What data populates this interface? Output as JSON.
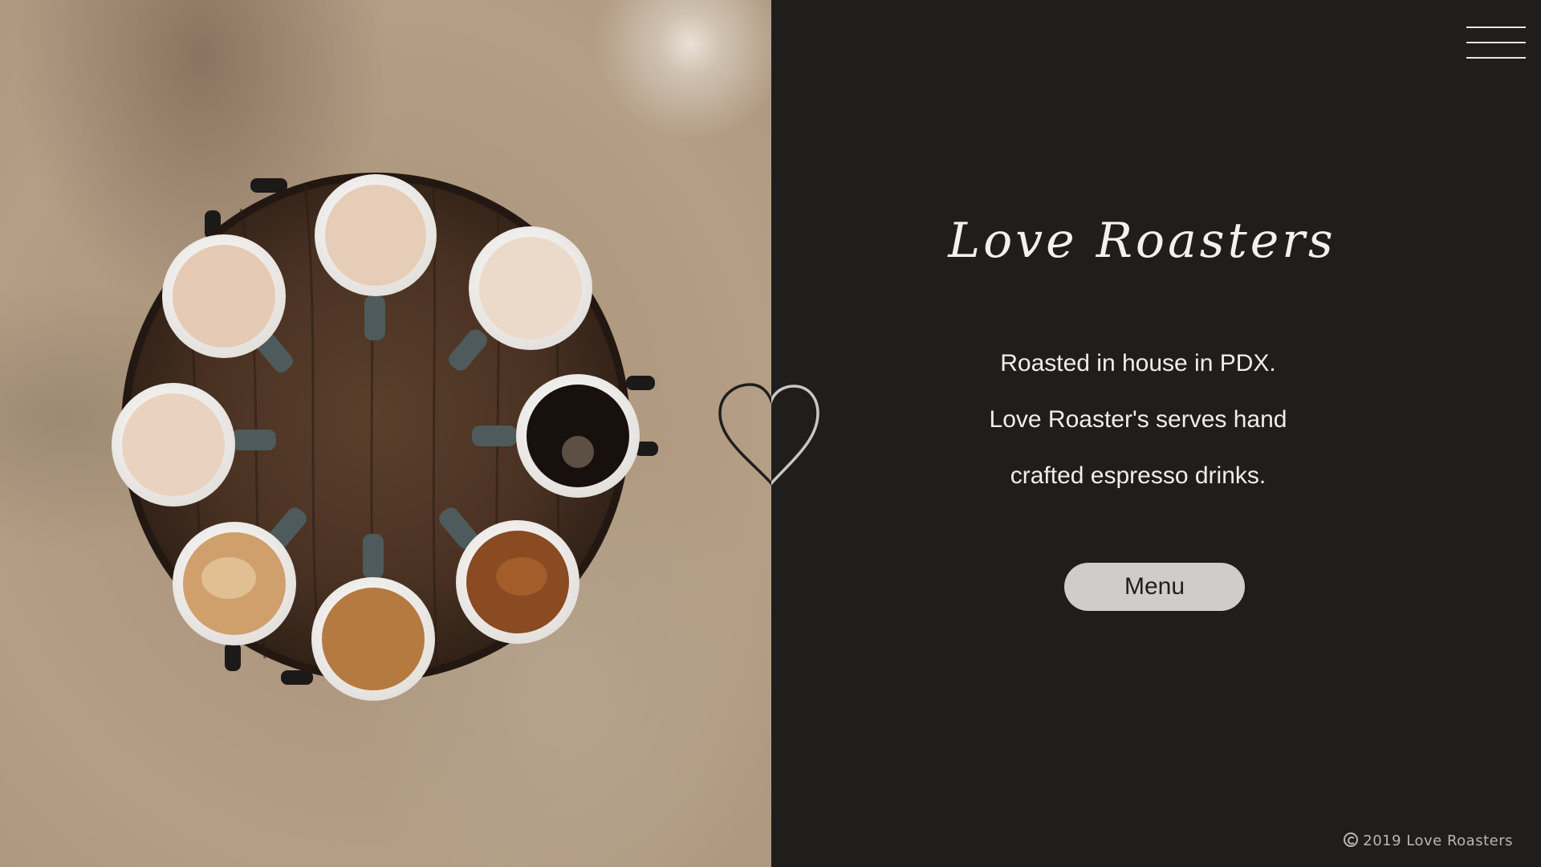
{
  "brand": {
    "title": "Love Roasters"
  },
  "hero": {
    "lines": [
      "Roasted in house in PDX.",
      "Love Roaster's serves hand",
      "crafted espresso drinks."
    ],
    "menu_button_label": "Menu"
  },
  "footer": {
    "copyright": "2019 Love Roasters"
  },
  "icons": {
    "hamburger": "menu-hamburger-icon",
    "heart": "heart-outline-icon",
    "copyright": "copyright-icon"
  },
  "colors": {
    "panel_dark": "#1f1e1d",
    "text_light": "#efeeec",
    "button_bg": "#cfcdca",
    "footer_text": "#b9b7b4"
  }
}
